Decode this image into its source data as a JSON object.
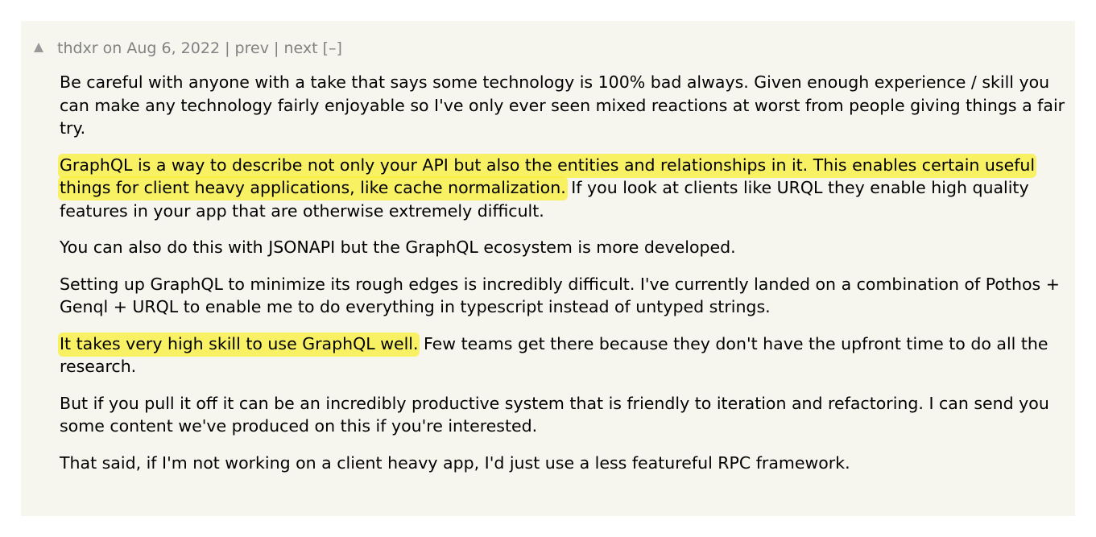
{
  "colors": {
    "comment_background": "#f6f6ef",
    "meta_text": "#828282",
    "body_text": "#000000",
    "highlight": "#f8ee3c"
  },
  "comment": {
    "vote_icon": "upvote-triangle-icon",
    "author": "thdxr",
    "on_word": "on",
    "date": "Aug 6, 2022",
    "separator": "|",
    "prev_label": "prev",
    "next_label": "next",
    "collapse_label": "[–]",
    "paragraphs": {
      "p1": "Be careful with anyone with a take that says some technology is 100% bad always. Given enough experience / skill you can make any technology fairly enjoyable so I've only ever seen mixed reactions at worst from people giving things a fair try.",
      "p2_highlight": "GraphQL is a way to describe not only your API but also the entities and relationships in it. This enables certain useful things for client heavy applications, like cache normalization.",
      "p2_rest": " If you look at clients like URQL they enable high quality features in your app that are otherwise extremely difficult.",
      "p3": "You can also do this with JSONAPI but the GraphQL ecosystem is more developed.",
      "p4": "Setting up GraphQL to minimize its rough edges is incredibly difficult. I've currently landed on a combination of Pothos + Genql + URQL to enable me to do everything in typescript instead of untyped strings.",
      "p5_highlight": "It takes very high skill to use GraphQL well.",
      "p5_rest": " Few teams get there because they don't have the upfront time to do all the research.",
      "p6": "But if you pull it off it can be an incredibly productive system that is friendly to iteration and refactoring. I can send you some content we've produced on this if you're interested.",
      "p7": "That said, if I'm not working on a client heavy app, I'd just use a less featureful RPC framework."
    }
  }
}
